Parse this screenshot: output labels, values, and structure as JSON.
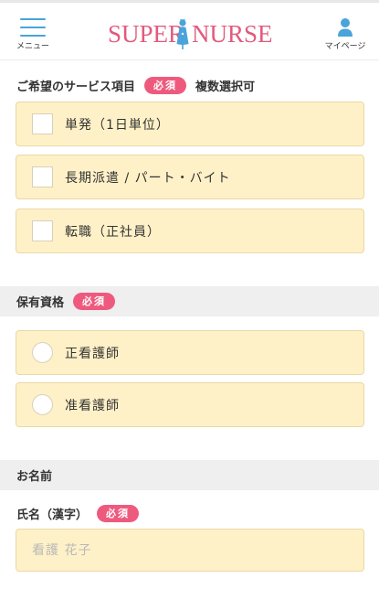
{
  "header": {
    "menu_label": "メニュー",
    "logo_left": "SUPER",
    "logo_right": "NURSE",
    "mypage_label": "マイページ"
  },
  "services": {
    "title": "ご希望のサービス項目",
    "required_badge": "必須",
    "note": "複数選択可",
    "options": [
      {
        "label": "単発（1日単位）",
        "checked": false
      },
      {
        "label": "長期派遣 / パート・バイト",
        "checked": false
      },
      {
        "label": "転職（正社員）",
        "checked": false
      }
    ]
  },
  "qualification": {
    "title": "保有資格",
    "required_badge": "必須",
    "options": [
      {
        "label": "正看護師",
        "selected": false
      },
      {
        "label": "准看護師",
        "selected": false
      }
    ]
  },
  "name_section": {
    "title": "お名前",
    "kanji_label": "氏名（漢字）",
    "required_badge": "必須",
    "kanji_value": "",
    "kanji_placeholder": "看護 花子"
  },
  "colors": {
    "brand_pink": "#e35a7d",
    "badge_pink": "#ee5a7e",
    "accent_blue": "#4aa3d9",
    "option_bg": "#fff1c7",
    "band_bg": "#efefef"
  },
  "icons": {
    "menu": "hamburger-icon",
    "mypage": "person-icon",
    "logo_mark": "nurse-figure-icon"
  }
}
